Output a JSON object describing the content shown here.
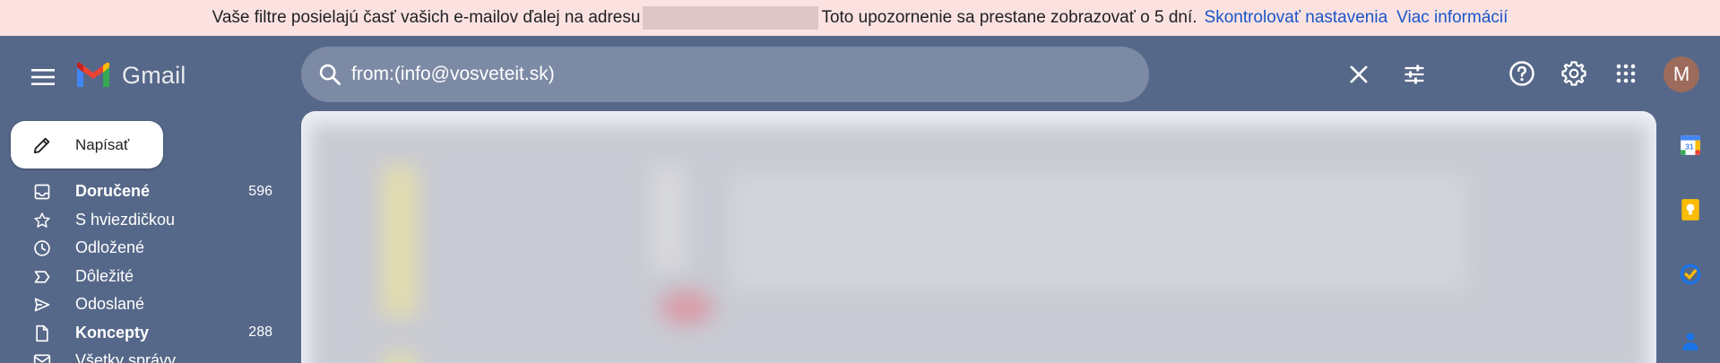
{
  "banner": {
    "text_before": "Vaše filtre posielajú časť vašich e-mailov ďalej na adresu",
    "text_after": "Toto upozornenie sa prestane zobrazovať o 5 dní.",
    "link_settings": "Skontrolovať nastavenia",
    "link_more": "Viac informácií"
  },
  "header": {
    "app_name": "Gmail",
    "search_value": "from:(info@vosveteit.sk)",
    "avatar_letter": "M"
  },
  "compose": {
    "label": "Napísať"
  },
  "sidebar": {
    "items": [
      {
        "label": "Doručené",
        "count": "596",
        "bold": true,
        "icon": "inbox-icon"
      },
      {
        "label": "S hviezdičkou",
        "count": "",
        "bold": false,
        "icon": "star-icon"
      },
      {
        "label": "Odložené",
        "count": "",
        "bold": false,
        "icon": "clock-icon"
      },
      {
        "label": "Dôležité",
        "count": "",
        "bold": false,
        "icon": "important-icon"
      },
      {
        "label": "Odoslané",
        "count": "",
        "bold": false,
        "icon": "send-icon"
      },
      {
        "label": "Koncepty",
        "count": "288",
        "bold": true,
        "icon": "draft-icon"
      },
      {
        "label": "Všetky správy",
        "count": "",
        "bold": false,
        "icon": "mail-icon"
      }
    ]
  },
  "colors": {
    "background": "#566889",
    "banner_bg": "#fbe2e1",
    "link": "#1a56c9",
    "search_bg": "#7d8aa5"
  }
}
